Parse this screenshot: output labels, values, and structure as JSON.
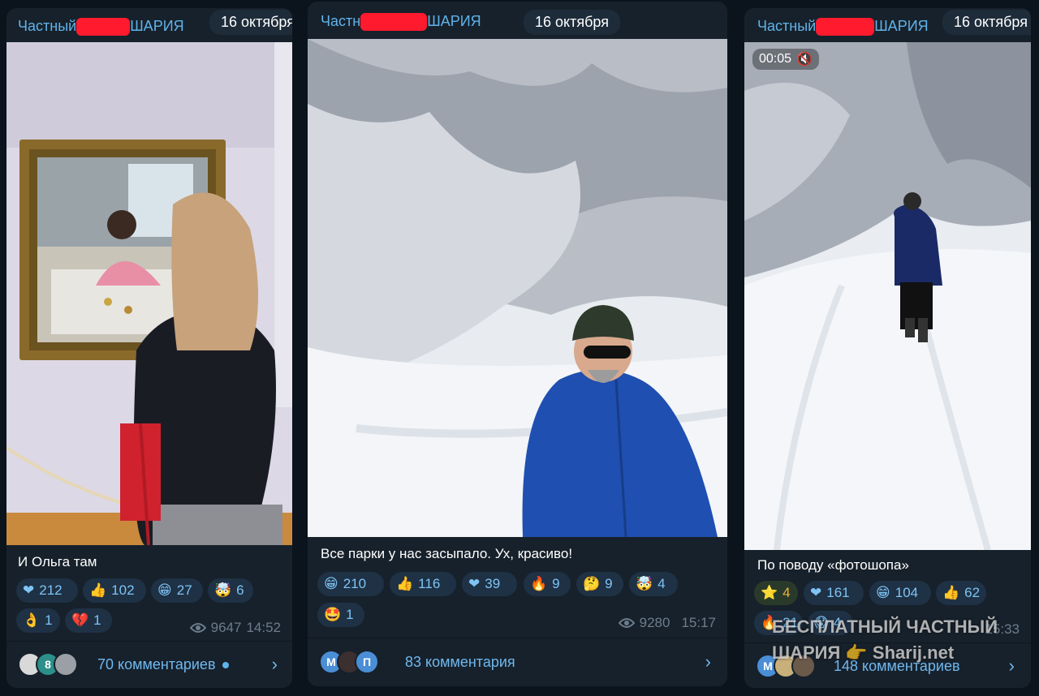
{
  "posts": [
    {
      "channel_prefix": "Частный",
      "channel_suffix": "ШАРИЯ",
      "date": "16 октября",
      "caption": "И Ольга там",
      "reactions": [
        {
          "emoji": "❤",
          "count": "212"
        },
        {
          "emoji": "👍",
          "count": "102"
        },
        {
          "emoji": "😁",
          "count": "27"
        },
        {
          "emoji": "🤯",
          "count": "6"
        },
        {
          "emoji": "👌",
          "count": "1"
        },
        {
          "emoji": "💔",
          "count": "1"
        }
      ],
      "views": "9647",
      "time": "14:52",
      "comments": "70 комментариев",
      "avatars": [
        " ",
        "8",
        " "
      ]
    },
    {
      "channel_prefix": "Частн",
      "channel_suffix": "ШАРИЯ",
      "date": "16 октября",
      "caption": "Все парки у нас засыпало. Ух, красиво!",
      "reactions": [
        {
          "emoji": "😁",
          "count": "210"
        },
        {
          "emoji": "👍",
          "count": "116"
        },
        {
          "emoji": "❤",
          "count": "39"
        },
        {
          "emoji": "🔥",
          "count": "9"
        },
        {
          "emoji": "🤔",
          "count": "9"
        },
        {
          "emoji": "🤯",
          "count": "4"
        },
        {
          "emoji": "🤩",
          "count": "1"
        }
      ],
      "views": "9280",
      "time": "15:17",
      "comments": "83 комментария",
      "avatars": [
        "М",
        " ",
        "П"
      ]
    },
    {
      "channel_prefix": "Частный",
      "channel_suffix": "ШАРИЯ",
      "date": "16 октября",
      "video_time": "00:05",
      "caption": "По поводу «фотошопа»",
      "reactions": [
        {
          "emoji": "⭐",
          "count": "4"
        },
        {
          "emoji": "❤",
          "count": "161"
        },
        {
          "emoji": "😁",
          "count": "104"
        },
        {
          "emoji": "👍",
          "count": "62"
        },
        {
          "emoji": "🔥",
          "count": "21"
        },
        {
          "emoji": "😱",
          "count": "4"
        }
      ],
      "time": "15:33",
      "comments": "148 комментариев",
      "avatars": [
        "М",
        " ",
        " "
      ],
      "watermark_line1": "БЕСПЛАТНЫЙ ЧАСТНЫЙ",
      "watermark_line2": "ШАРИЯ 👉 Sharij.net"
    }
  ],
  "colors": {
    "background": "#0b141d",
    "card": "#17212b",
    "accent": "#5fb3ea",
    "reaction_bg": "#1f3145",
    "redaction": "#ff1a2d"
  }
}
